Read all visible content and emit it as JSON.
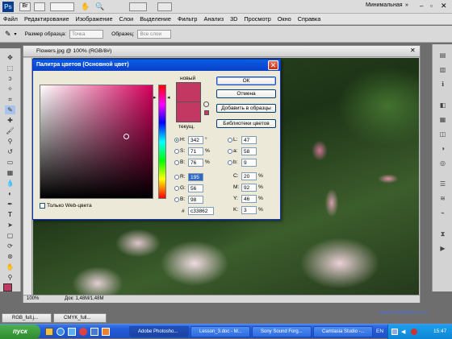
{
  "app": {
    "logo": "Ps",
    "workspace": "Минимальная",
    "colors": {
      "brand": "#0a5ce8",
      "current": "#c33862"
    }
  },
  "menu": [
    "Файл",
    "Редактирование",
    "Изображение",
    "Слои",
    "Выделение",
    "Фильтр",
    "Анализ",
    "3D",
    "Просмотр",
    "Окно",
    "Справка"
  ],
  "options": {
    "sample_size_label": "Размер образца:",
    "sample_size_value": "Точка",
    "sample_label": "Образец:",
    "sample_value": "Все слои"
  },
  "document": {
    "title": "Flowers.jpg @ 100% (RGB/8#)",
    "zoom": "100%",
    "doc_info": "Док: 1,48M/1,48M"
  },
  "dialog": {
    "title": "Палитра цветов (Основной цвет)",
    "new_label": "новый",
    "current_label": "текущ.",
    "ok": "ОК",
    "cancel": "Отмена",
    "add_swatch": "Добавить в образцы",
    "libraries": "Библиотеки цветов",
    "web_only": "Только Web-цвета",
    "hsb": {
      "h": "342",
      "h_unit": "°",
      "s": "71",
      "s_unit": "%",
      "b": "76",
      "b_unit": "%"
    },
    "rgb": {
      "r": "195",
      "g": "56",
      "b": "98"
    },
    "lab": {
      "l": "47",
      "a": "58",
      "b": "9"
    },
    "cmyk": {
      "c": "20",
      "m": "92",
      "y": "46",
      "k": "3",
      "unit": "%"
    },
    "hex_label": "#",
    "hex": "c33862"
  },
  "tabs": [
    "RGB_full.j...",
    "CMYK_full..."
  ],
  "watermark": "www.NashKurs.ru",
  "taskbar": {
    "start": "пуск",
    "items": [
      "Adobe Photosho...",
      "Lesson_3.doc - M...",
      "Sony Sound Forg...",
      "Camtasia Studio -..."
    ],
    "lang": "EN",
    "clock": "15:47"
  }
}
